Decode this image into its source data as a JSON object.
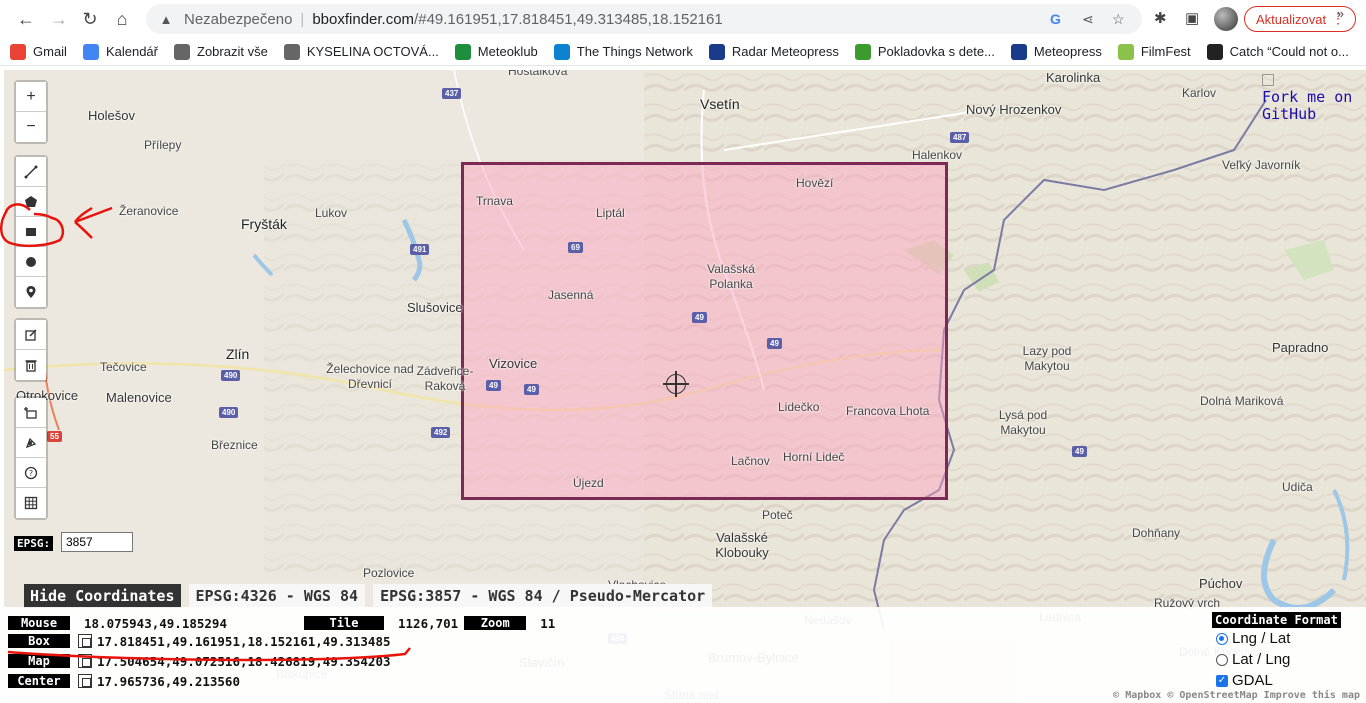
{
  "browser": {
    "security_text": "Nezabezpečeno",
    "url_host": "bboxfinder.com",
    "url_path": "/#49.161951,17.818451,49.313485,18.152161",
    "update_label": "Aktualizovat"
  },
  "bookmarks": [
    {
      "label": "Gmail",
      "color": "#ea4335"
    },
    {
      "label": "Kalendář",
      "color": "#4285f4"
    },
    {
      "label": "Zobrazit vše",
      "color": "#666666"
    },
    {
      "label": "KYSELINA OCTOVÁ...",
      "color": "#666666"
    },
    {
      "label": "Meteoklub",
      "color": "#1e8e3e"
    },
    {
      "label": "The Things Network",
      "color": "#0d83d0"
    },
    {
      "label": "Radar Meteopress",
      "color": "#1a3a8a"
    },
    {
      "label": "Pokladovka s dete...",
      "color": "#3b9b2c"
    },
    {
      "label": "Meteopress",
      "color": "#1a3a8a"
    },
    {
      "label": "FilmFest",
      "color": "#8bc34a"
    },
    {
      "label": "Catch “Could not o...",
      "color": "#222222"
    }
  ],
  "bookmarks_more": "»",
  "map": {
    "places": [
      {
        "name": "Hostalkova",
        "cls": "small"
      },
      {
        "name": "Vsetín",
        "cls": "big"
      },
      {
        "name": "Karolinka",
        "cls": ""
      },
      {
        "name": "Karlov",
        "cls": "small"
      },
      {
        "name": "Holešov",
        "cls": ""
      },
      {
        "name": "Nový Hrozenkov",
        "cls": ""
      },
      {
        "name": "Přílepy",
        "cls": "small"
      },
      {
        "name": "Halenkov",
        "cls": "small"
      },
      {
        "name": "Veľký Javorník",
        "cls": "small"
      },
      {
        "name": "Hovězí",
        "cls": "small"
      },
      {
        "name": "Trnava",
        "cls": "small"
      },
      {
        "name": "Žeranovice",
        "cls": "small"
      },
      {
        "name": "Liptál",
        "cls": "small"
      },
      {
        "name": "Fryšták",
        "cls": "big"
      },
      {
        "name": "Lukov",
        "cls": "small"
      },
      {
        "name": "Valašská Polanka",
        "cls": "small"
      },
      {
        "name": "Jasenná",
        "cls": "small"
      },
      {
        "name": "Slušovice",
        "cls": ""
      },
      {
        "name": "Zlín",
        "cls": "big"
      },
      {
        "name": "Lazy pod Makytou",
        "cls": "small"
      },
      {
        "name": "Papradno",
        "cls": ""
      },
      {
        "name": "Vizovice",
        "cls": ""
      },
      {
        "name": "Tečovice",
        "cls": "small"
      },
      {
        "name": "Želechovice nad Dřevnicí",
        "cls": "small"
      },
      {
        "name": "Zádveřice-Raková",
        "cls": "small"
      },
      {
        "name": "Otrokovice",
        "cls": ""
      },
      {
        "name": "Malenovice",
        "cls": ""
      },
      {
        "name": "Lidečko",
        "cls": "small"
      },
      {
        "name": "Francova Lhota",
        "cls": "small"
      },
      {
        "name": "Dolná Mariková",
        "cls": "small"
      },
      {
        "name": "Lysá pod Makytou",
        "cls": "small"
      },
      {
        "name": "Březnice",
        "cls": "small"
      },
      {
        "name": "Lačnov",
        "cls": "small"
      },
      {
        "name": "Horní Lideč",
        "cls": "small"
      },
      {
        "name": "Újezd",
        "cls": "small"
      },
      {
        "name": "Udiča",
        "cls": "small"
      },
      {
        "name": "Poteč",
        "cls": "small"
      },
      {
        "name": "Valašské Klobouky",
        "cls": ""
      },
      {
        "name": "Dohňany",
        "cls": "small"
      },
      {
        "name": "Pozlovice",
        "cls": "small"
      },
      {
        "name": "Vlachovice",
        "cls": "small"
      },
      {
        "name": "Púchov",
        "cls": ""
      },
      {
        "name": "Ružový vrch",
        "cls": "small"
      },
      {
        "name": "Lednica",
        "cls": "small"
      },
      {
        "name": "Nedašov",
        "cls": "small"
      },
      {
        "name": "Brumov-Bylnice",
        "cls": ""
      },
      {
        "name": "Slavičín",
        "cls": ""
      },
      {
        "name": "Biskupice",
        "cls": "small"
      },
      {
        "name": "Dolné Kočkovce",
        "cls": "small"
      },
      {
        "name": "Štítná nad",
        "cls": "small"
      }
    ],
    "roads": [
      {
        "num": "437",
        "red": false
      },
      {
        "num": "487",
        "red": false
      },
      {
        "num": "491",
        "red": false
      },
      {
        "num": "69",
        "red": false
      },
      {
        "num": "49",
        "red": false
      },
      {
        "num": "49",
        "red": false
      },
      {
        "num": "490",
        "red": false
      },
      {
        "num": "49",
        "red": false
      },
      {
        "num": "49",
        "red": false
      },
      {
        "num": "490",
        "red": false
      },
      {
        "num": "55",
        "red": true
      },
      {
        "num": "492",
        "red": false
      },
      {
        "num": "49",
        "red": false
      },
      {
        "num": "494",
        "red": false
      }
    ],
    "github": "Fork me on GitHub",
    "epsg_label": "EPSG:",
    "epsg_value": "3857",
    "attribution": "© Mapbox © OpenStreetMap Improve this map"
  },
  "controls": {
    "zoom_in": "+",
    "zoom_out": "−"
  },
  "coords": {
    "hide_label": "Hide Coordinates",
    "tab_wgs84": "EPSG:4326 - WGS 84",
    "tab_mercator": "EPSG:3857 - WGS 84 / Pseudo-Mercator",
    "mouse_label": "Mouse",
    "mouse_value": "18.075943,49.185294",
    "tile_label": "Tile",
    "tile_value": "1126,701",
    "zoom_label": "Zoom",
    "zoom_value": "11",
    "box_label": "Box",
    "box_value": "17.818451,49.161951,18.152161,49.313485",
    "map_label": "Map",
    "map_value": "17.504654,49.072516,18.426819,49.354203",
    "center_label": "Center",
    "center_value": "17.965736,49.213560",
    "format_title": "Coordinate Format",
    "format_lnglat": "Lng / Lat",
    "format_latlng": "Lat / Lng",
    "format_gdal": "GDAL"
  },
  "colors": {
    "bbox_fill": "#ffa0be",
    "bbox_stroke": "#7a2a55",
    "annotation": "#e8140c"
  }
}
